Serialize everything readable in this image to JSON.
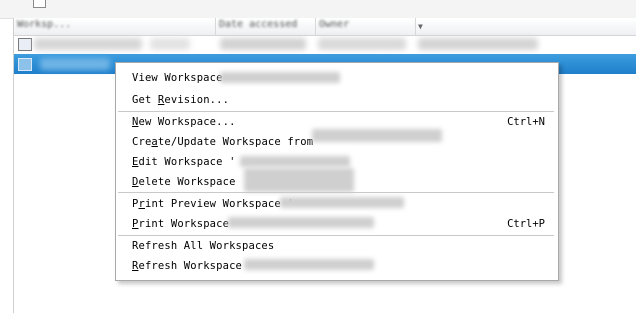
{
  "list": {
    "columns": [
      "Worksp...",
      "Date accessed",
      "Owner",
      ""
    ]
  },
  "menu": {
    "items": [
      {
        "id": "view",
        "label": "View Workspace",
        "shortcut": ""
      },
      {
        "id": "get-revision",
        "label": "Get Revision...",
        "mnemonic": "R",
        "shortcut": ""
      },
      {
        "id": "new",
        "label": "New Workspace...",
        "mnemonic": "N",
        "shortcut": "Ctrl+N"
      },
      {
        "id": "create-update",
        "label": "Create/Update Workspace from",
        "mnemonic": "a",
        "shortcut": ""
      },
      {
        "id": "edit",
        "label": "Edit Workspace '",
        "mnemonic": "E",
        "shortcut": ""
      },
      {
        "id": "delete",
        "label": "Delete Workspace",
        "mnemonic": "D",
        "shortcut": ""
      },
      {
        "id": "print-preview",
        "label": "Print Preview Workspace '",
        "mnemonic": "r",
        "shortcut": ""
      },
      {
        "id": "print",
        "label": "Print Workspace",
        "mnemonic": "P",
        "shortcut": "Ctrl+P"
      },
      {
        "id": "refresh-all",
        "label": "Refresh All Workspaces",
        "shortcut": ""
      },
      {
        "id": "refresh",
        "label": "Refresh Workspace",
        "mnemonic": "R",
        "shortcut": ""
      }
    ]
  }
}
